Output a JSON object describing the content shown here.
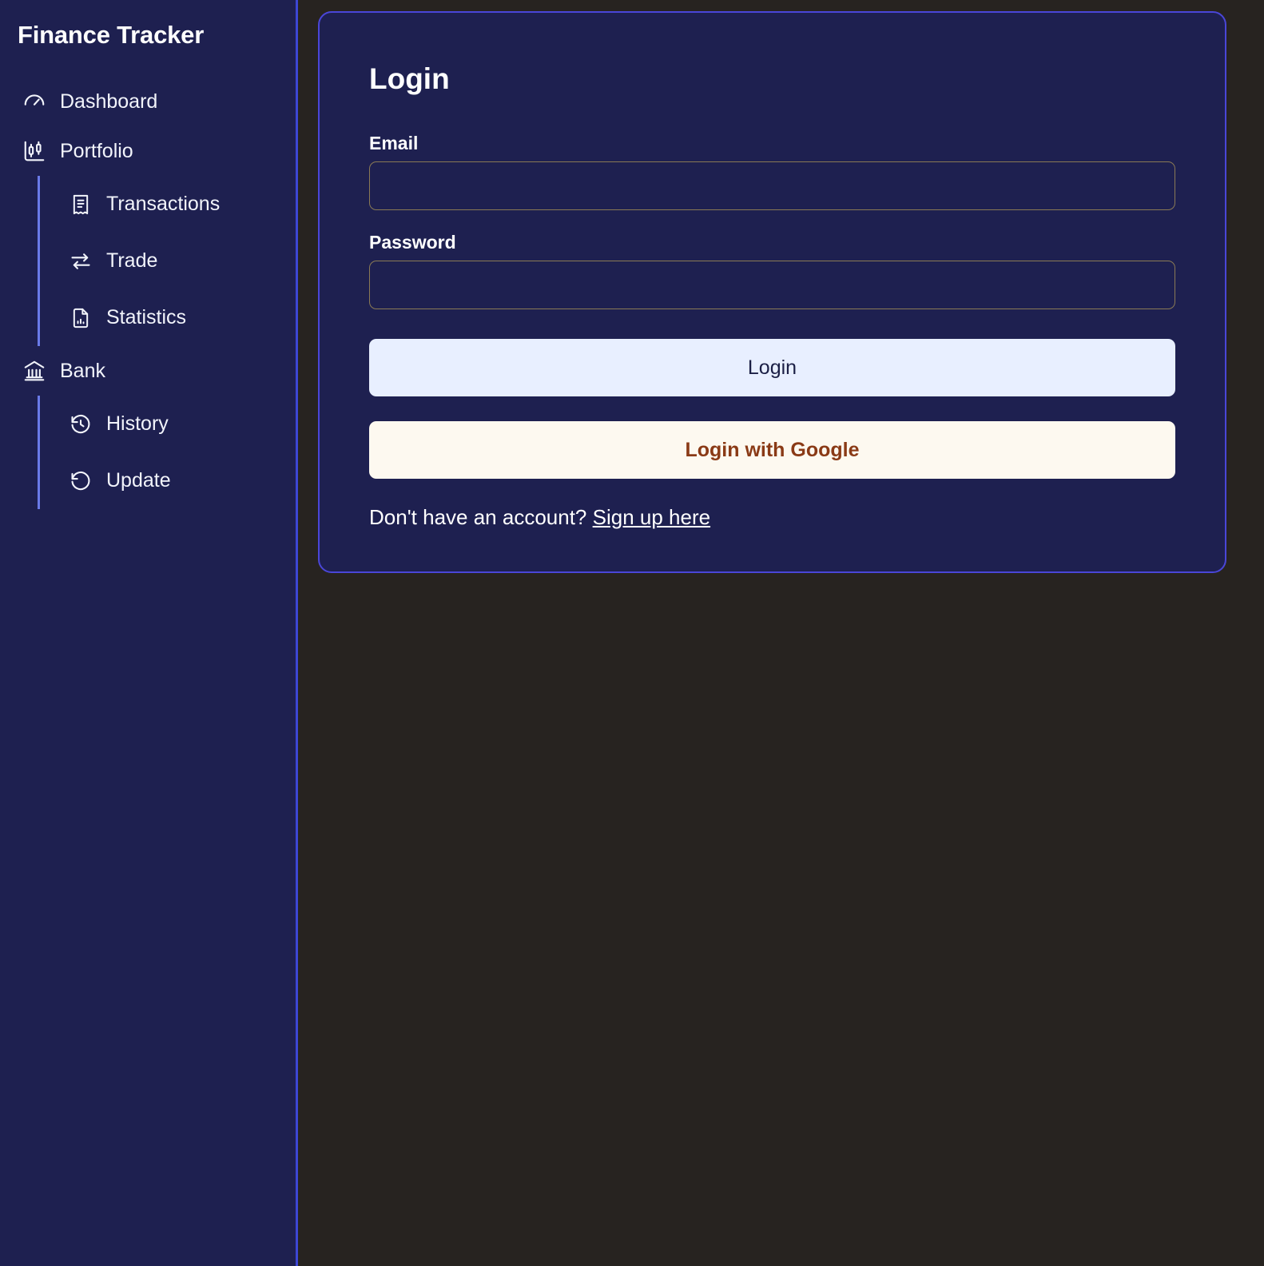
{
  "sidebar": {
    "brand": "Finance Tracker",
    "items": [
      {
        "label": "Dashboard",
        "icon": "gauge-icon",
        "level": 0
      },
      {
        "label": "Portfolio",
        "icon": "candlestick-chart-icon",
        "level": 0
      },
      {
        "label": "Transactions",
        "icon": "receipt-icon",
        "level": 1
      },
      {
        "label": "Trade",
        "icon": "exchange-arrows-icon",
        "level": 1
      },
      {
        "label": "Statistics",
        "icon": "document-chart-icon",
        "level": 1
      },
      {
        "label": "Bank",
        "icon": "bank-building-icon",
        "level": 0
      },
      {
        "label": "History",
        "icon": "clock-history-icon",
        "level": 1
      },
      {
        "label": "Update",
        "icon": "rotate-ccw-icon",
        "level": 1
      }
    ]
  },
  "login": {
    "title": "Login",
    "email": {
      "label": "Email",
      "value": "",
      "placeholder": ""
    },
    "password": {
      "label": "Password",
      "value": "",
      "placeholder": ""
    },
    "submit_label": "Login",
    "google_label": "Login with Google",
    "signup_prompt": "Don't have an account?",
    "signup_link": "Sign up here"
  },
  "colors": {
    "page_background": "#272320",
    "panel_background": "#1e2050",
    "sidebar_border": "#3d47d4",
    "card_border": "#4a46d8",
    "group_line": "#6a7ae8",
    "input_border": "#8a7a55",
    "primary_button_bg": "#e8efff",
    "primary_button_text": "#1b1f45",
    "google_button_bg": "#fdf9f0",
    "google_button_text": "#8a3a16",
    "text": "#ffffff"
  }
}
